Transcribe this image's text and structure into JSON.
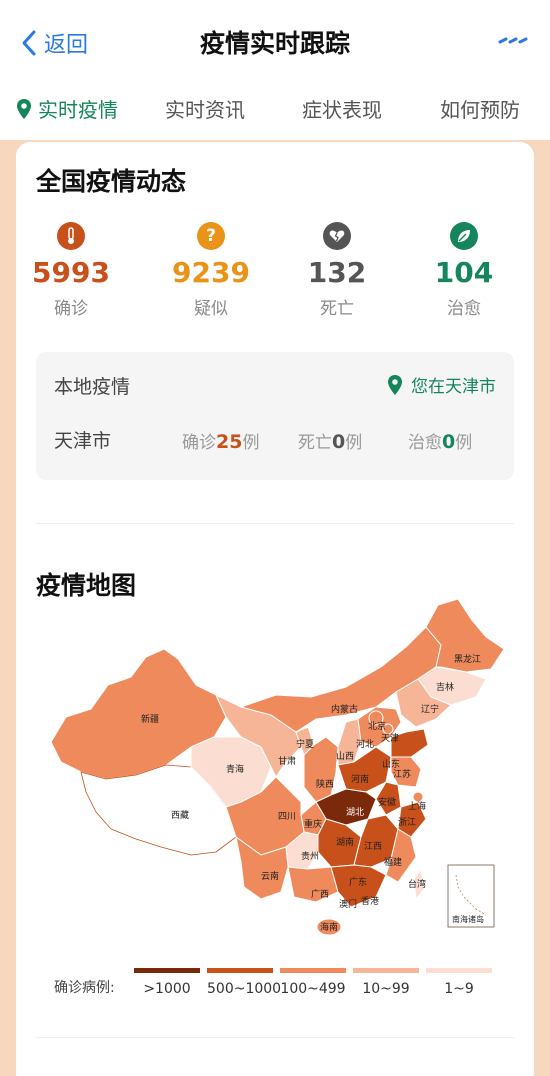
{
  "header": {
    "back_label": "返回",
    "title": "疫情实时跟踪"
  },
  "tabs": [
    {
      "label": "实时疫情",
      "active": true
    },
    {
      "label": "实时资讯",
      "active": false
    },
    {
      "label": "症状表现",
      "active": false
    },
    {
      "label": "如何预防",
      "active": false
    }
  ],
  "national": {
    "title": "全国疫情动态",
    "stats": [
      {
        "value": "5993",
        "label": "确诊",
        "color": "#c8501a",
        "icon": "thermometer-icon"
      },
      {
        "value": "9239",
        "label": "疑似",
        "color": "#e99419",
        "icon": "question-icon"
      },
      {
        "value": "132",
        "label": "死亡",
        "color": "#555555",
        "icon": "broken-heart-icon"
      },
      {
        "value": "104",
        "label": "治愈",
        "color": "#15855b",
        "icon": "leaf-icon"
      }
    ]
  },
  "local": {
    "title": "本地疫情",
    "location_text": "您在天津市",
    "city": "天津市",
    "confirmed": {
      "prefix": "确诊",
      "value": "25",
      "suffix": "例"
    },
    "deaths": {
      "prefix": "死亡",
      "value": "0",
      "suffix": "例"
    },
    "cured": {
      "prefix": "治愈",
      "value": "0",
      "suffix": "例"
    }
  },
  "map": {
    "title": "疫情地图",
    "provinces": [
      "新疆",
      "西藏",
      "青海",
      "甘肃",
      "宁夏",
      "内蒙古",
      "黑龙江",
      "吉林",
      "辽宁",
      "北京",
      "天津",
      "河北",
      "山西",
      "陕西",
      "四川",
      "重庆",
      "云南",
      "贵州",
      "广西",
      "广东",
      "湖南",
      "湖北",
      "河南",
      "山东",
      "江苏",
      "安徽",
      "浙江",
      "上海",
      "江西",
      "福建",
      "台湾",
      "香港",
      "澳门",
      "海南"
    ],
    "inset_label": "南海诸岛"
  },
  "legend": {
    "title": "确诊病例:",
    "items": [
      {
        "label": ">1000",
        "color": "#7a2a0a"
      },
      {
        "label": "500~1000",
        "color": "#c8501a"
      },
      {
        "label": "100~499",
        "color": "#ee8a5c"
      },
      {
        "label": "10~99",
        "color": "#f6b596"
      },
      {
        "label": "1~9",
        "color": "#fbded1"
      }
    ]
  }
}
